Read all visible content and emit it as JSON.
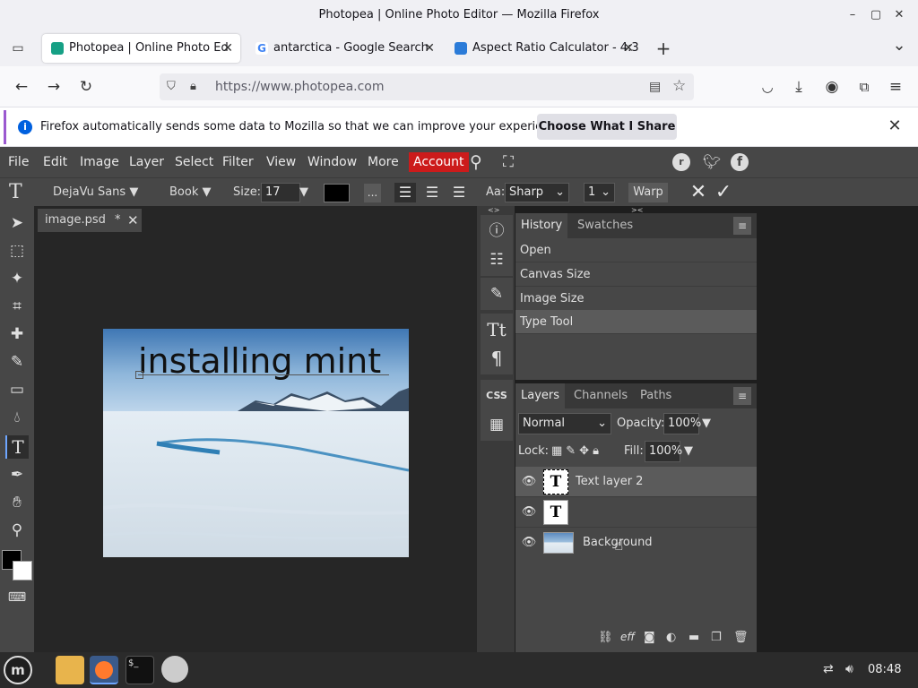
{
  "window": {
    "title": "Photopea | Online Photo Editor — Mozilla Firefox",
    "min": "–",
    "max": "▢",
    "close": "✕"
  },
  "tabs": [
    {
      "label": "Photopea | Online Photo Ed",
      "active": true,
      "color": "#16a085"
    },
    {
      "label": "antarctica - Google Search",
      "active": false,
      "color": "#4285f4"
    },
    {
      "label": "Aspect Ratio Calculator - 4:3",
      "active": false,
      "color": "#2b7bd8"
    }
  ],
  "tab_add": "+",
  "tab_list": "⌄",
  "nav": {
    "back": "←",
    "forward": "→",
    "reload": "↻",
    "url": "https://www.photopea.com"
  },
  "notification": {
    "text": "Firefox automatically sends some data to Mozilla so that we can improve your experience.",
    "button": "Choose What I Share",
    "close": "✕",
    "info": "i"
  },
  "menu": [
    "File",
    "Edit",
    "Image",
    "Layer",
    "Select",
    "Filter",
    "View",
    "Window",
    "More"
  ],
  "account": "Account",
  "options": {
    "tool": "T",
    "font": "DejaVu Sans ▼",
    "style": "Book ▼",
    "size_label": "Size:",
    "size_value": "17 px",
    "size_arrow": "▼",
    "more": "...",
    "aa_label": "Aa:",
    "aa_value": "Sharp",
    "line_value": "1",
    "warp": "Warp",
    "cancel": "✕",
    "commit": "✓"
  },
  "document": {
    "tab_label": "image.psd",
    "tab_modified": "*",
    "tab_close": "✕",
    "text": "installing mint"
  },
  "history": {
    "tabs": [
      "History",
      "Swatches"
    ],
    "items": [
      "Open",
      "Canvas Size",
      "Image Size",
      "Type Tool"
    ],
    "menu_icon": "≡"
  },
  "layers": {
    "tabs": [
      "Layers",
      "Channels",
      "Paths"
    ],
    "blend": "Normal",
    "opacity_label": "Opacity:",
    "opacity_value": "100%",
    "lock_label": "Lock:",
    "fill_label": "Fill:",
    "fill_value": "100%",
    "items": [
      {
        "name": "Text layer 2",
        "thumb": "T"
      },
      {
        "name": "",
        "thumb": "T"
      },
      {
        "name": "Background",
        "thumb": ""
      }
    ],
    "menu_icon": "≡"
  },
  "panel_expand": "<>",
  "panel_collapse": "><",
  "taskbar": {
    "clock": "08:48"
  }
}
